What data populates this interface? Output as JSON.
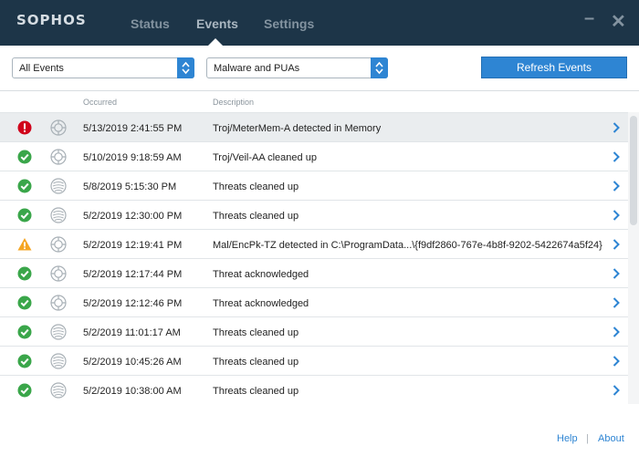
{
  "app": {
    "logo": "SOPHOS"
  },
  "nav": {
    "tabs": [
      {
        "label": "Status"
      },
      {
        "label": "Events"
      },
      {
        "label": "Settings"
      }
    ],
    "active": "Events"
  },
  "window": {
    "minimize": "–",
    "close": "✕"
  },
  "toolbar": {
    "filter_event": "All Events",
    "filter_type": "Malware and PUAs",
    "refresh_label": "Refresh Events"
  },
  "columns": {
    "occurred": "Occurred",
    "description": "Description"
  },
  "events": [
    {
      "severity": "error",
      "type": "scan",
      "occurred": "5/13/2019 2:41:55 PM",
      "description": "Troj/MeterMem-A detected in Memory"
    },
    {
      "severity": "ok",
      "type": "scan",
      "occurred": "5/10/2019 9:18:59 AM",
      "description": "Troj/Veil-AA cleaned up"
    },
    {
      "severity": "ok",
      "type": "web",
      "occurred": "5/8/2019 5:15:30 PM",
      "description": "Threats cleaned up"
    },
    {
      "severity": "ok",
      "type": "web",
      "occurred": "5/2/2019 12:30:00 PM",
      "description": "Threats cleaned up"
    },
    {
      "severity": "warning",
      "type": "scan",
      "occurred": "5/2/2019 12:19:41 PM",
      "description": "Mal/EncPk-TZ detected in C:\\ProgramData...\\{f9df2860-767e-4b8f-9202-5422674a5f24}"
    },
    {
      "severity": "ok",
      "type": "scan",
      "occurred": "5/2/2019 12:17:44 PM",
      "description": "Threat acknowledged"
    },
    {
      "severity": "ok",
      "type": "scan",
      "occurred": "5/2/2019 12:12:46 PM",
      "description": "Threat acknowledged"
    },
    {
      "severity": "ok",
      "type": "web",
      "occurred": "5/2/2019 11:01:17 AM",
      "description": "Threats cleaned up"
    },
    {
      "severity": "ok",
      "type": "web",
      "occurred": "5/2/2019 10:45:26 AM",
      "description": "Threats cleaned up"
    },
    {
      "severity": "ok",
      "type": "web",
      "occurred": "5/2/2019 10:38:00 AM",
      "description": "Threats cleaned up"
    }
  ],
  "footer": {
    "help": "Help",
    "separator": "|",
    "about": "About"
  },
  "colors": {
    "titlebar": "#1d3548",
    "accent": "#2e85d3",
    "ok": "#3aa64a",
    "error": "#d0021b",
    "warning": "#f5a623"
  }
}
